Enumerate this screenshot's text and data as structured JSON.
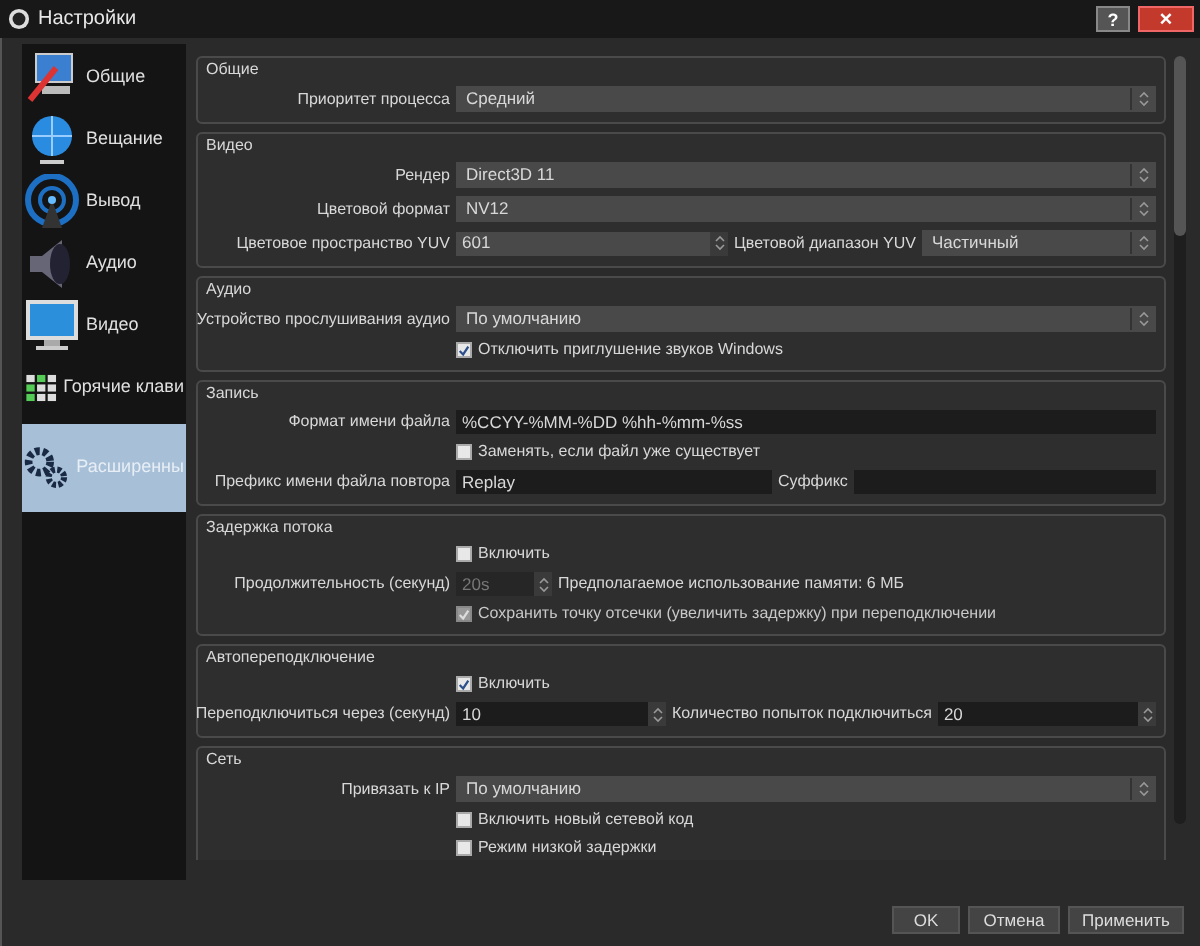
{
  "window": {
    "title": "Настройки",
    "help_button": "?",
    "close_button": "×"
  },
  "sidebar": {
    "items": [
      {
        "label": "Общие",
        "selected": false
      },
      {
        "label": "Вещание",
        "selected": false
      },
      {
        "label": "Вывод",
        "selected": false
      },
      {
        "label": "Аудио",
        "selected": false
      },
      {
        "label": "Видео",
        "selected": false
      },
      {
        "label": "Горячие клави",
        "selected": false
      },
      {
        "label": "Расширенны",
        "selected": true
      }
    ]
  },
  "sections": [
    {
      "title": "Общие",
      "rows": [
        {
          "kind": "select",
          "label": "Приоритет процесса",
          "value": "Средний"
        }
      ]
    },
    {
      "title": "Видео",
      "rows": [
        {
          "kind": "select",
          "label": "Рендер",
          "value": "Direct3D 11"
        },
        {
          "kind": "select",
          "label": "Цветовой формат",
          "value": "NV12"
        },
        {
          "kind": "select_pair",
          "label": "Цветовое пространство YUV",
          "value": "601",
          "label2": "Цветовой диапазон YUV",
          "value2": "Частичный"
        }
      ]
    },
    {
      "title": "Аудио",
      "rows": [
        {
          "kind": "select",
          "label": "Устройство прослушивания аудио",
          "value": "По умолчанию"
        },
        {
          "kind": "checkbox",
          "label": "Отключить приглушение звуков Windows",
          "checked": true,
          "disabled": false
        }
      ]
    },
    {
      "title": "Запись",
      "rows": [
        {
          "kind": "text",
          "label": "Формат имени файла",
          "value": "%CCYY-%MM-%DD %hh-%mm-%ss"
        },
        {
          "kind": "checkbox",
          "label": "Заменять, если файл уже существует",
          "checked": false,
          "disabled": false
        },
        {
          "kind": "text_pair",
          "label": "Префикс имени файла повтора",
          "value": "Replay",
          "label2": "Суффикс",
          "value2": ""
        }
      ]
    },
    {
      "title": "Задержка потока",
      "rows": [
        {
          "kind": "checkbox",
          "label": "Включить",
          "checked": false,
          "disabled": false
        },
        {
          "kind": "spin_note",
          "label": "Продолжительность (секунд)",
          "value": "20s",
          "disabled": true,
          "note": "Предполагаемое использование памяти: 6 МБ"
        },
        {
          "kind": "checkbox",
          "label": "Сохранить точку отсечки (увеличить задержку) при переподключении",
          "checked": true,
          "disabled": true
        }
      ]
    },
    {
      "title": "Автопереподключение",
      "rows": [
        {
          "kind": "checkbox",
          "label": "Включить",
          "checked": true,
          "disabled": false
        },
        {
          "kind": "spin_pair",
          "label": "Переподключиться через (секунд)",
          "value": "10",
          "label2": "Количество попыток подключиться",
          "value2": "20"
        }
      ]
    },
    {
      "title": "Сеть",
      "rows": [
        {
          "kind": "select",
          "label": "Привязать к IP",
          "value": "По умолчанию"
        },
        {
          "kind": "checkbox",
          "label": "Включить новый сетевой код",
          "checked": false,
          "disabled": false
        },
        {
          "kind": "checkbox",
          "label": "Режим низкой задержки",
          "checked": false,
          "disabled": false
        }
      ]
    }
  ],
  "buttons": [
    "OK",
    "Отмена",
    "Применить"
  ]
}
